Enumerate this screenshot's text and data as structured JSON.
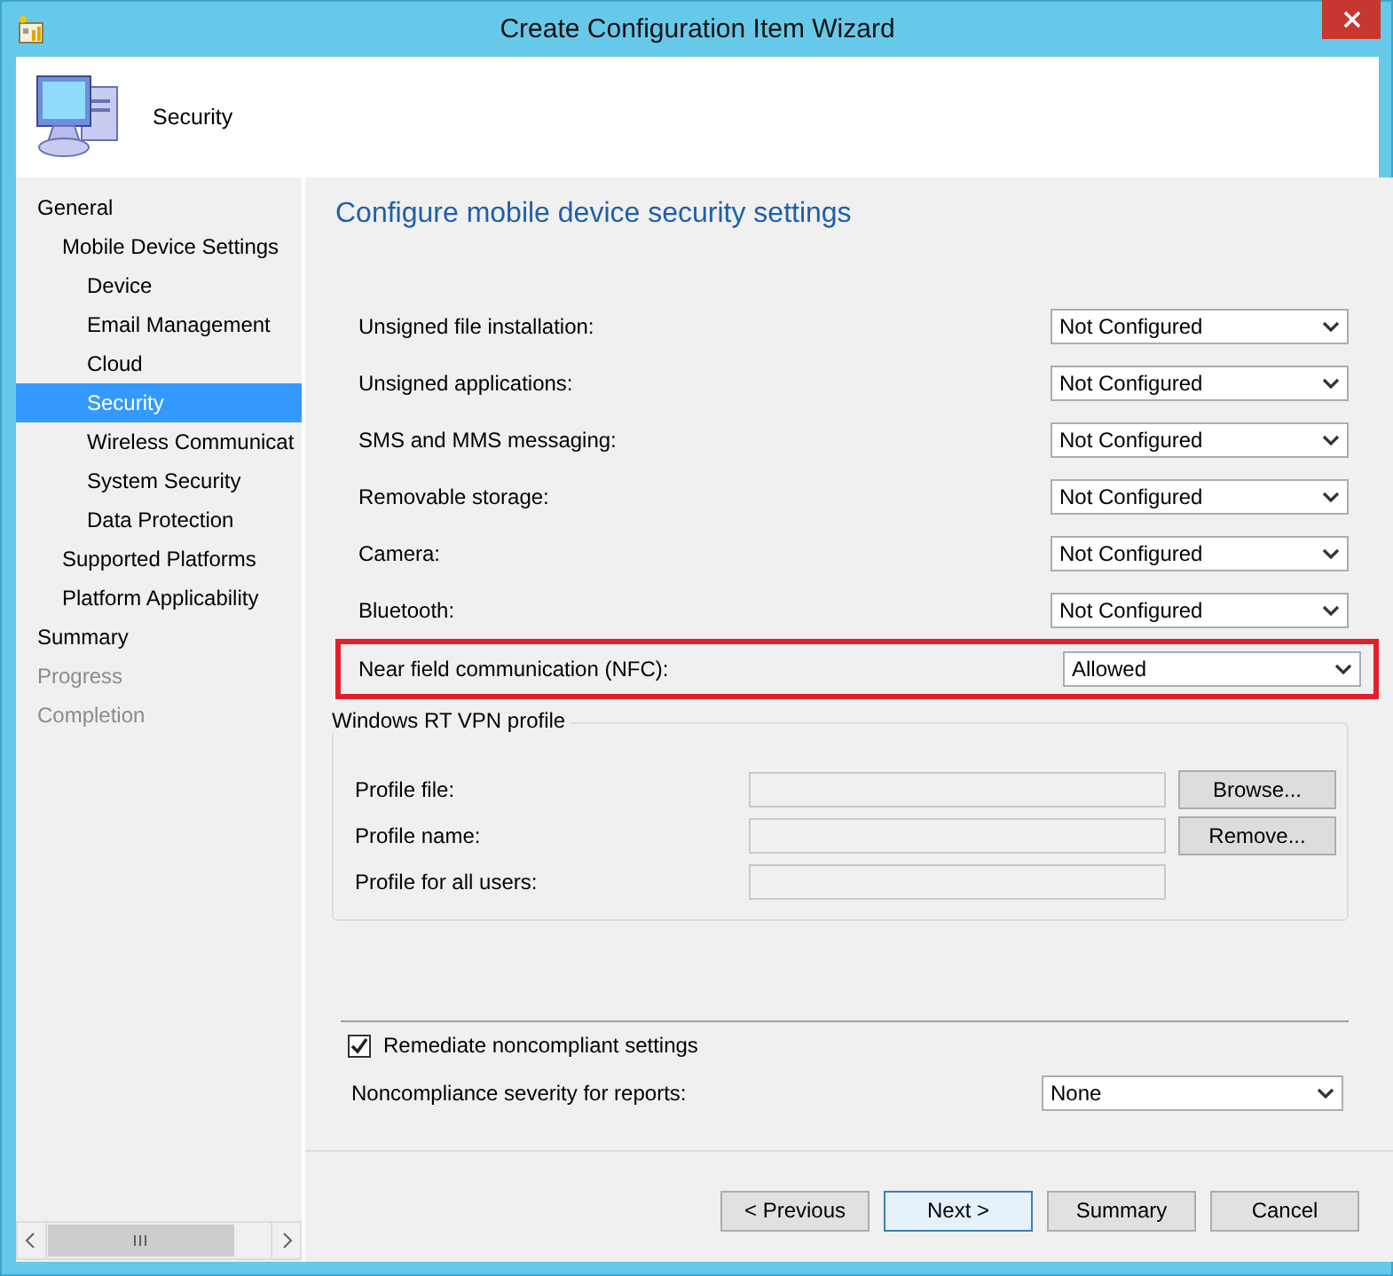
{
  "window": {
    "title": "Create Configuration Item Wizard"
  },
  "header": {
    "title": "Security"
  },
  "navigation": [
    {
      "label": "General",
      "selected": false,
      "disabled": false,
      "children": [
        {
          "label": "Mobile Device Settings",
          "selected": false,
          "disabled": false,
          "children": [
            {
              "label": "Device",
              "selected": false,
              "disabled": false
            },
            {
              "label": "Email Management",
              "selected": false,
              "disabled": false
            },
            {
              "label": "Cloud",
              "selected": false,
              "disabled": false
            },
            {
              "label": "Security",
              "selected": true,
              "disabled": false
            },
            {
              "label": "Wireless Communicat",
              "selected": false,
              "disabled": false
            },
            {
              "label": "System Security",
              "selected": false,
              "disabled": false
            },
            {
              "label": "Data Protection",
              "selected": false,
              "disabled": false
            }
          ]
        },
        {
          "label": "Supported Platforms",
          "selected": false,
          "disabled": false
        },
        {
          "label": "Platform Applicability",
          "selected": false,
          "disabled": false
        }
      ]
    },
    {
      "label": "Summary",
      "selected": false,
      "disabled": false
    },
    {
      "label": "Progress",
      "selected": false,
      "disabled": true
    },
    {
      "label": "Completion",
      "selected": false,
      "disabled": true
    }
  ],
  "page_title": "Configure mobile device security settings",
  "settings": [
    {
      "label": "Unsigned file installation:",
      "value": "Not Configured",
      "highlighted": false
    },
    {
      "label": "Unsigned applications:",
      "value": "Not Configured",
      "highlighted": false
    },
    {
      "label": "SMS and MMS messaging:",
      "value": "Not Configured",
      "highlighted": false
    },
    {
      "label": "Removable storage:",
      "value": "Not Configured",
      "highlighted": false
    },
    {
      "label": "Camera:",
      "value": "Not Configured",
      "highlighted": false
    },
    {
      "label": "Bluetooth:",
      "value": "Not Configured",
      "highlighted": false
    },
    {
      "label": "Near field communication (NFC):",
      "value": "Allowed",
      "highlighted": true
    }
  ],
  "vpn_profile": {
    "title": "Windows RT VPN profile",
    "fields": [
      {
        "label": "Profile file:"
      },
      {
        "label": "Profile name:"
      },
      {
        "label": "Profile for all users:"
      }
    ],
    "buttons": [
      "Browse...",
      "Remove..."
    ]
  },
  "remediate": {
    "label": "Remediate noncompliant settings",
    "checked": true
  },
  "severity": {
    "label": "Noncompliance severity for reports:",
    "value": "None"
  },
  "buttons": [
    {
      "label": "< Previous",
      "default": false
    },
    {
      "label": "Next >",
      "default": true
    },
    {
      "label": "Summary",
      "default": false
    },
    {
      "label": "Cancel",
      "default": false
    }
  ]
}
